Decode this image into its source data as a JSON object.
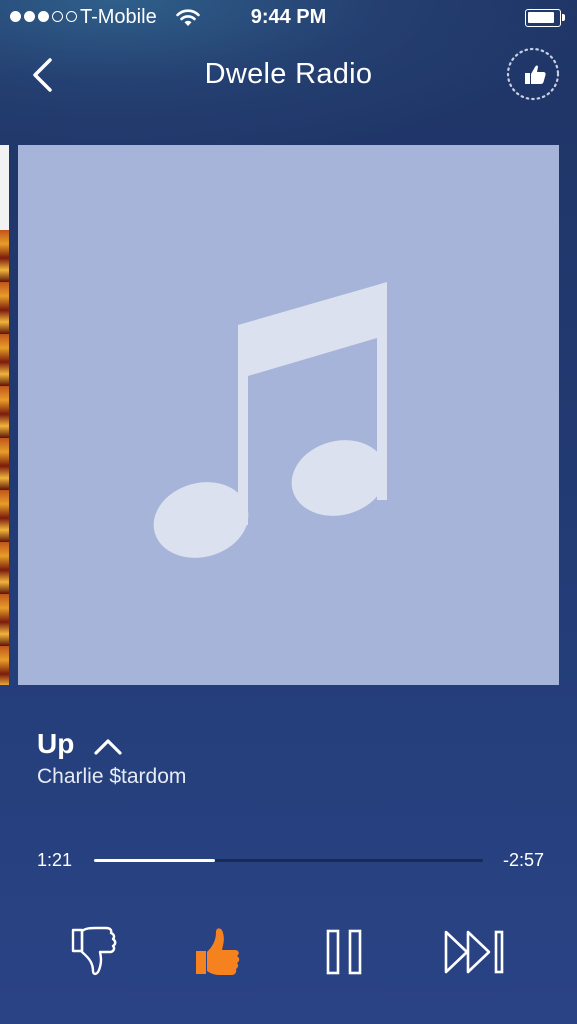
{
  "status_bar": {
    "signal_bars": 3,
    "signal_max": 5,
    "carrier": "T-Mobile",
    "time": "9:44 PM",
    "battery_level": 0.9
  },
  "nav": {
    "title": "Dwele Radio",
    "back_icon": "chevron-left-icon",
    "thumbprint_icon": "thumbprint-radio-icon"
  },
  "album_art": {
    "placeholder_icon": "music-note-icon",
    "background_color": "#a7b4d9",
    "icon_color": "#dce1ef"
  },
  "track": {
    "title": "Up",
    "artist": "Charlie $tardom",
    "elapsed": "1:21",
    "remaining": "-2:57",
    "progress": 0.31
  },
  "controls": {
    "thumbs_down_icon": "thumbs-down-icon",
    "thumbs_up_icon": "thumbs-up-icon",
    "thumbs_up_active_color": "#f5821f",
    "pause_icon": "pause-icon",
    "skip_icon": "skip-forward-icon"
  },
  "colors": {
    "background_top": "#1f3566",
    "background_bottom": "#2a4385"
  }
}
